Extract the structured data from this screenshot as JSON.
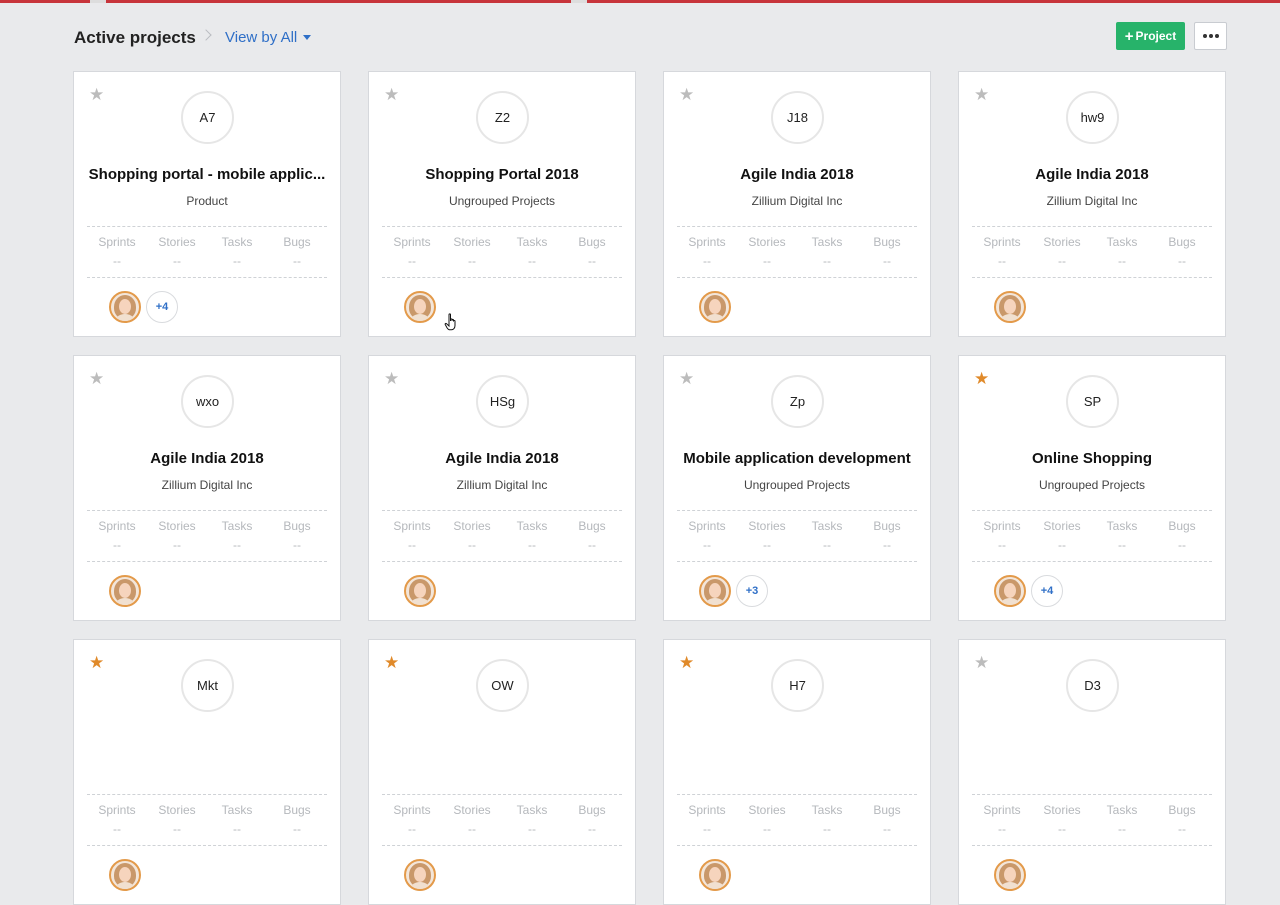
{
  "header": {
    "title": "Active projects",
    "view_by": "View by All",
    "add_project_label": "Project"
  },
  "stat_labels": [
    "Sprints",
    "Stories",
    "Tasks",
    "Bugs"
  ],
  "projects": [
    {
      "code": "A7",
      "name": "Shopping portal - mobile applic...",
      "group": "Product",
      "starred": false,
      "stats": [
        "--",
        "--",
        "--",
        "--"
      ],
      "extra_members": "+4"
    },
    {
      "code": "Z2",
      "name": "Shopping Portal 2018",
      "group": "Ungrouped Projects",
      "starred": false,
      "stats": [
        "--",
        "--",
        "--",
        "--"
      ],
      "extra_members": ""
    },
    {
      "code": "J18",
      "name": "Agile India 2018",
      "group": "Zillium Digital Inc",
      "starred": false,
      "stats": [
        "--",
        "--",
        "--",
        "--"
      ],
      "extra_members": ""
    },
    {
      "code": "hw9",
      "name": "Agile India 2018",
      "group": "Zillium Digital Inc",
      "starred": false,
      "stats": [
        "--",
        "--",
        "--",
        "--"
      ],
      "extra_members": ""
    },
    {
      "code": "wxo",
      "name": "Agile India 2018",
      "group": "Zillium Digital Inc",
      "starred": false,
      "stats": [
        "--",
        "--",
        "--",
        "--"
      ],
      "extra_members": ""
    },
    {
      "code": "HSg",
      "name": "Agile India 2018",
      "group": "Zillium Digital Inc",
      "starred": false,
      "stats": [
        "--",
        "--",
        "--",
        "--"
      ],
      "extra_members": ""
    },
    {
      "code": "Zp",
      "name": "Mobile application development",
      "group": "Ungrouped Projects",
      "starred": false,
      "stats": [
        "--",
        "--",
        "--",
        "--"
      ],
      "extra_members": "+3"
    },
    {
      "code": "SP",
      "name": "Online Shopping",
      "group": "Ungrouped Projects",
      "starred": true,
      "stats": [
        "--",
        "--",
        "--",
        "--"
      ],
      "extra_members": "+4"
    },
    {
      "code": "Mkt",
      "name": "",
      "group": "",
      "starred": true,
      "stats": [
        "--",
        "--",
        "--",
        "--"
      ],
      "extra_members": ""
    },
    {
      "code": "OW",
      "name": "",
      "group": "",
      "starred": true,
      "stats": [
        "--",
        "--",
        "--",
        "--"
      ],
      "extra_members": ""
    },
    {
      "code": "H7",
      "name": "",
      "group": "",
      "starred": true,
      "stats": [
        "--",
        "--",
        "--",
        "--"
      ],
      "extra_members": ""
    },
    {
      "code": "D3",
      "name": "",
      "group": "",
      "starred": false,
      "stats": [
        "--",
        "--",
        "--",
        "--"
      ],
      "extra_members": ""
    }
  ],
  "colors": {
    "accent_blue": "#2f6fc7",
    "add_button_green": "#27b36a",
    "star_active": "#e08a2a",
    "star_inactive": "#bcbcbc"
  }
}
